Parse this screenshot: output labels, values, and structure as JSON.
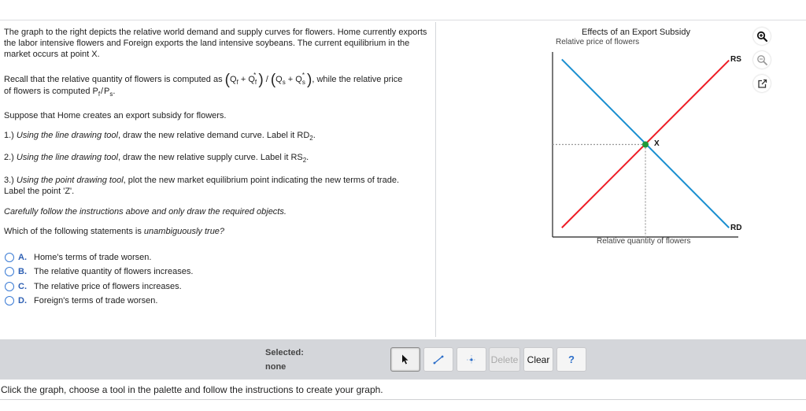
{
  "question": {
    "intro": "The graph to the right depicts the relative world demand and supply curves for flowers. Home currently exports the labor intensive flowers and Foreign exports the land intensive soybeans. The current equilibrium in the market occurs at point X.",
    "recall_prefix": "Recall that the relative quantity of flowers is computed as",
    "recall_suffix": ", while the relative price",
    "recall_line2_prefix": "of flowers is computed",
    "formula": {
      "q": "Q",
      "f": "f",
      "s": "s",
      "plus": "+",
      "star": "*",
      "slash": "/",
      "p": "P",
      "open": "(",
      "close": ")",
      "period": "."
    },
    "subsidy": "Suppose that Home creates an export subsidy for flowers.",
    "step1_num": "1.)",
    "step1_italic": "Using the line drawing tool",
    "step1_text": ", draw the new relative demand curve. Label it RD",
    "step1_sub": "2",
    "step2_num": "2.)",
    "step2_italic": "Using the line drawing tool",
    "step2_text": ", draw the new relative supply curve. Label it RS",
    "step2_sub": "2",
    "step3_num": "3.)",
    "step3_italic": "Using the point drawing tool",
    "step3_text": ", plot the new market equilibrium point indicating the new terms of trade.",
    "step3_line2": "Label the point 'Z'.",
    "caution": "Carefully follow the instructions above and only draw the required objects.",
    "prompt_prefix": "Which of the following statements is",
    "prompt_italic": "unambiguously true?",
    "choices": [
      {
        "letter": "A.",
        "text": "Home's terms of trade worsen."
      },
      {
        "letter": "B.",
        "text": "The relative quantity of flowers increases."
      },
      {
        "letter": "C.",
        "text": "The relative price of flowers increases."
      },
      {
        "letter": "D.",
        "text": "Foreign's terms of trade worsen."
      }
    ]
  },
  "graph": {
    "title": "Effects of an Export Subsidy",
    "ylabel": "Relative price of flowers",
    "xlabel": "Relative quantity of flowers",
    "colors": {
      "rd": "#1a8fd0",
      "rs": "#ee1c25",
      "point": "#1f9a3a",
      "axis": "#222222",
      "guide": "#999999"
    },
    "chart_data": {
      "type": "line",
      "xlim": [
        0,
        10
      ],
      "ylim": [
        0,
        10
      ],
      "series": [
        {
          "name": "RD",
          "points": [
            [
              0.5,
              9.6
            ],
            [
              9.5,
              0.5
            ]
          ]
        },
        {
          "name": "RS",
          "points": [
            [
              0.5,
              0.5
            ],
            [
              9.5,
              9.55
            ]
          ]
        }
      ],
      "points": [
        {
          "label": "X",
          "x": 5,
          "y": 5
        }
      ]
    },
    "labels": {
      "rs": "RS",
      "rd": "RD",
      "x": "X"
    },
    "icons": [
      "zoom-in-icon",
      "zoom-out-icon",
      "popout-icon"
    ]
  },
  "toolbar": {
    "selected_label": "Selected:",
    "selected_value": "none",
    "delete_label": "Delete",
    "clear_label": "Clear",
    "help_label": "?"
  },
  "footer": {
    "instruction": "Click the graph, choose a tool in the palette and follow the instructions to create your graph."
  }
}
